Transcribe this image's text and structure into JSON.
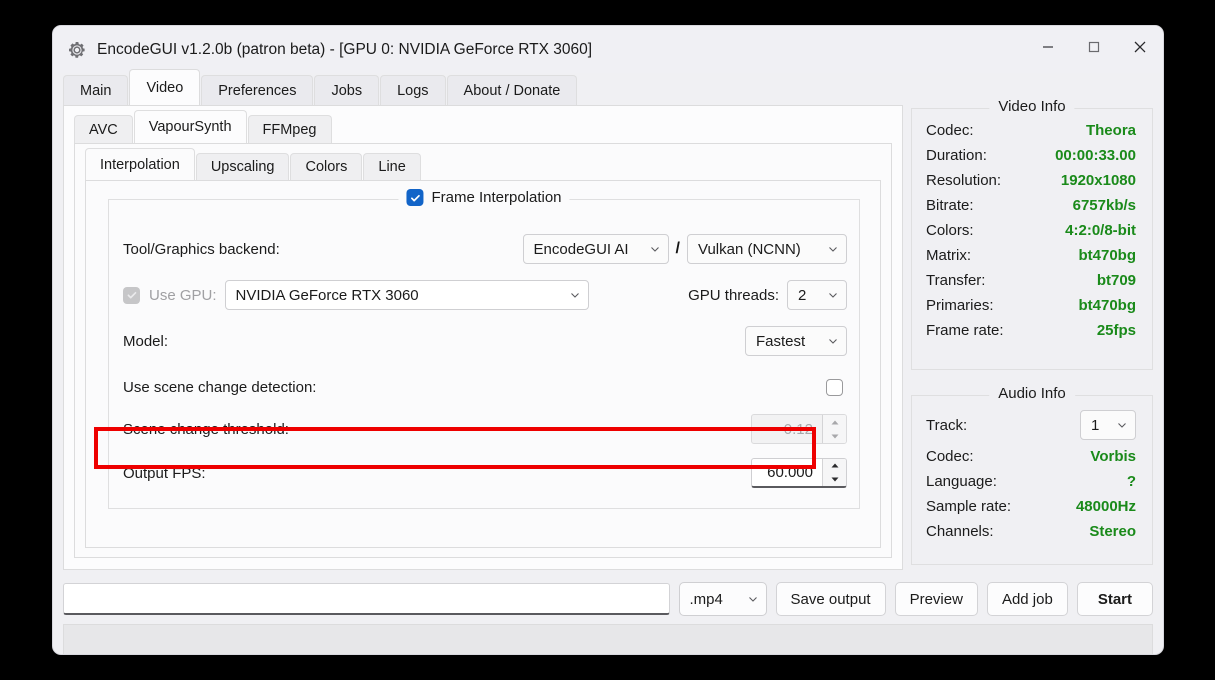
{
  "window": {
    "title": "EncodeGUI v1.2.0b (patron beta) - [GPU 0: NVIDIA GeForce RTX 3060]",
    "icon": "gear-icon",
    "controls": {
      "minimize": "minimize-icon",
      "maximize": "maximize-icon",
      "close": "close-icon"
    }
  },
  "tabs_main": [
    {
      "label": "Main",
      "active": false
    },
    {
      "label": "Video",
      "active": true
    },
    {
      "label": "Preferences",
      "active": false
    },
    {
      "label": "Jobs",
      "active": false
    },
    {
      "label": "Logs",
      "active": false
    },
    {
      "label": "About / Donate",
      "active": false
    }
  ],
  "tabs_video": [
    {
      "label": "AVC",
      "active": false
    },
    {
      "label": "VapourSynth",
      "active": true
    },
    {
      "label": "FFMpeg",
      "active": false
    }
  ],
  "tabs_vs": [
    {
      "label": "Interpolation",
      "active": true
    },
    {
      "label": "Upscaling",
      "active": false
    },
    {
      "label": "Colors",
      "active": false
    },
    {
      "label": "Line",
      "active": false
    }
  ],
  "interpolation": {
    "group_label": "Frame Interpolation",
    "group_checked": true,
    "backend_label": "Tool/Graphics backend:",
    "tool_value": "EncodeGUI AI",
    "separator": "/",
    "graphics_value": "Vulkan (NCNN)",
    "use_gpu_label": "Use GPU:",
    "use_gpu_checked": true,
    "gpu_value": "NVIDIA GeForce RTX 3060",
    "gpu_threads_label": "GPU threads:",
    "gpu_threads_value": "2",
    "model_label": "Model:",
    "model_value": "Fastest",
    "scene_detect_label": "Use scene change detection:",
    "scene_detect_checked": false,
    "scene_threshold_label": "Scene change threshold:",
    "scene_threshold_value": "0.12",
    "output_fps_label": "Output FPS:",
    "output_fps_value": "60.000"
  },
  "video_info": {
    "title": "Video Info",
    "value_color": "#1a8a1a",
    "rows": [
      {
        "key": "Codec:",
        "value": "Theora"
      },
      {
        "key": "Duration:",
        "value": "00:00:33.00"
      },
      {
        "key": "Resolution:",
        "value": "1920x1080"
      },
      {
        "key": "Bitrate:",
        "value": "6757kb/s"
      },
      {
        "key": "Colors:",
        "value": "4:2:0/8-bit"
      },
      {
        "key": "Matrix:",
        "value": "bt470bg"
      },
      {
        "key": "Transfer:",
        "value": "bt709"
      },
      {
        "key": "Primaries:",
        "value": "bt470bg"
      },
      {
        "key": "Frame rate:",
        "value": "25fps"
      }
    ]
  },
  "audio_info": {
    "title": "Audio Info",
    "value_color": "#1a8a1a",
    "track_label": "Track:",
    "track_value": "1",
    "rows": [
      {
        "key": "Codec:",
        "value": "Vorbis"
      },
      {
        "key": "Language:",
        "value": "?"
      },
      {
        "key": "Sample rate:",
        "value": "48000Hz"
      },
      {
        "key": "Channels:",
        "value": "Stereo"
      }
    ]
  },
  "bottom": {
    "output_path_value": "",
    "output_path_placeholder": "",
    "container_value": ".mp4",
    "save_output_label": "Save output",
    "preview_label": "Preview",
    "add_job_label": "Add job",
    "start_label": "Start"
  },
  "status_bar": {
    "text": ""
  },
  "colors": {
    "accent_checkbox": "#1264c8",
    "highlight_box": "#ee0000",
    "info_value": "#1a8a1a"
  }
}
